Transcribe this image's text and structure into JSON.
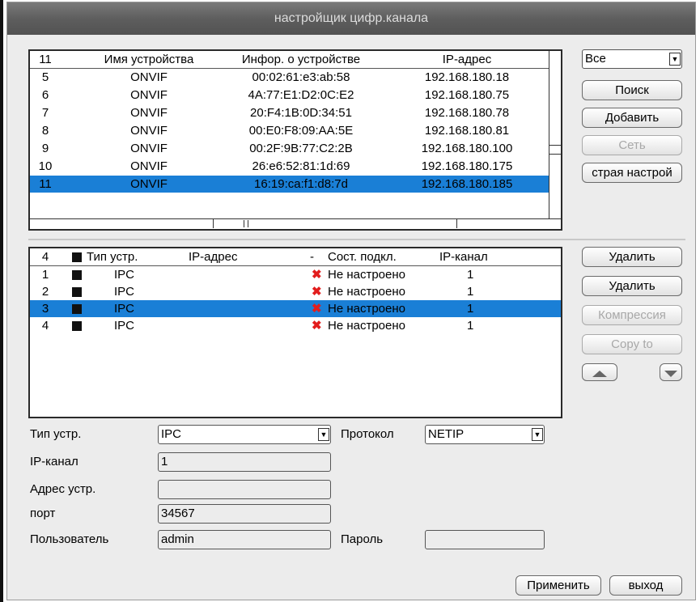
{
  "window": {
    "title": "настройщик цифр.канала"
  },
  "top_table": {
    "headers": [
      "11",
      "Имя устройства",
      "Инфор. о устройстве",
      "IP-адрес"
    ],
    "rows": [
      [
        "5",
        "ONVIF",
        "00:02:61:e3:ab:58",
        "192.168.180.18"
      ],
      [
        "6",
        "ONVIF",
        "4A:77:E1:D2:0C:E2",
        "192.168.180.75"
      ],
      [
        "7",
        "ONVIF",
        "20:F4:1B:0D:34:51",
        "192.168.180.78"
      ],
      [
        "8",
        "ONVIF",
        "00:E0:F8:09:AA:5E",
        "192.168.180.81"
      ],
      [
        "9",
        "ONVIF",
        "00:2F:9B:77:C2:2B",
        "192.168.180.100"
      ],
      [
        "10",
        "ONVIF",
        "26:e6:52:81:1d:69",
        "192.168.180.175"
      ],
      [
        "11",
        "ONVIF",
        "16:19:ca:f1:d8:7d",
        "192.168.180.185"
      ]
    ],
    "selected_index": 6
  },
  "top_buttons": {
    "filter_value": "Все",
    "search": "Поиск",
    "add": "Добавить",
    "network": "Сеть",
    "quick_setup": "страя настрой"
  },
  "bottom_table": {
    "headers": [
      "4",
      "Тип устр.",
      "IP-адрес",
      "-",
      "Сост. подкл.",
      "IP-канал"
    ],
    "rows": [
      [
        "1",
        "IPC",
        "",
        "Не настроено",
        "1"
      ],
      [
        "2",
        "IPC",
        "",
        "Не настроено",
        "1"
      ],
      [
        "3",
        "IPC",
        "",
        "Не настроено",
        "1"
      ],
      [
        "4",
        "IPC",
        "",
        "Не настроено",
        "1"
      ]
    ],
    "selected_index": 2,
    "status_icon": "x-icon",
    "status_color": "#e21d1d"
  },
  "bottom_buttons": {
    "delete1": "Удалить",
    "delete2": "Удалить",
    "compression": "Компрессия",
    "copy_to": "Copy to"
  },
  "form": {
    "device_type_label": "Тип устр.",
    "device_type_value": "IPC",
    "protocol_label": "Протокол",
    "protocol_value": "NETIP",
    "ip_channel_label": "IP-канал",
    "ip_channel_value": "1",
    "device_address_label": "Адрес устр.",
    "device_address_value": "",
    "port_label": "порт",
    "port_value": "34567",
    "user_label": "Пользователь",
    "user_value": "admin",
    "password_label": "Пароль",
    "password_value": ""
  },
  "footer": {
    "apply": "Применить",
    "exit": "выход"
  },
  "colors": {
    "selection": "#1a7fd6",
    "title_bg": "#5e5e5e",
    "panel_bg": "#ececec"
  }
}
